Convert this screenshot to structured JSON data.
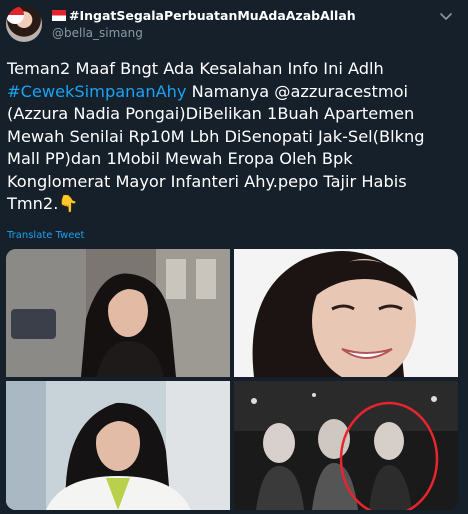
{
  "header": {
    "display_name": "#IngatSegalaPerbuatanMuAdaAzabAllah",
    "handle": "@bella_simang"
  },
  "tweet": {
    "text_part1": "Teman2 Maaf Bngt Ada Kesalahan Info Ini Adlh ",
    "hashtag": "#CewekSimpananAhy",
    "text_part2": " Namanya @azzuracestmoi (Azzura Nadia Pongai)DiBelikan 1Buah Apartemen Mewah Senilai Rp10M Lbh DiSenopati Jak-Sel(Blkng Mall PP)dan 1Mobil Mewah Eropa Oleh Bpk Konglomerat Mayor Infanteri Ahy.pepo Tajir Habis Tmn2.",
    "emoji": "👇",
    "translate_label": "Translate Tweet"
  },
  "icons": {
    "caret": "chevron-down-icon",
    "flag": "indonesia-flag-icon"
  },
  "colors": {
    "background": "#15202b",
    "link": "#1da1f2",
    "secondary_text": "#8899a6"
  }
}
